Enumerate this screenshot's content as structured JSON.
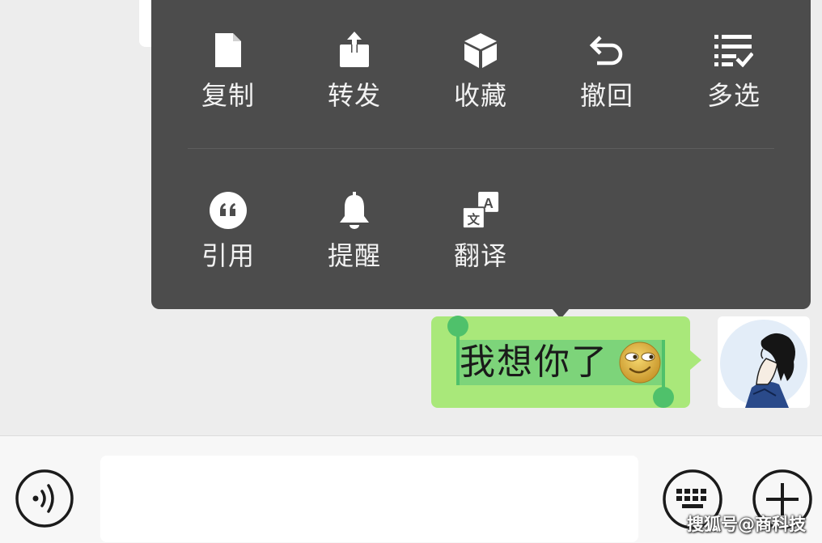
{
  "menu": {
    "row1": [
      {
        "label": "复制",
        "icon": "copy-document-icon"
      },
      {
        "label": "转发",
        "icon": "forward-share-icon"
      },
      {
        "label": "收藏",
        "icon": "favorite-cube-icon"
      },
      {
        "label": "撤回",
        "icon": "recall-undo-icon"
      },
      {
        "label": "多选",
        "icon": "multi-select-list-icon"
      }
    ],
    "row2": [
      {
        "label": "引用",
        "icon": "quote-icon"
      },
      {
        "label": "提醒",
        "icon": "remind-bell-icon"
      },
      {
        "label": "翻译",
        "icon": "translate-icon"
      }
    ]
  },
  "message": {
    "text": "我想你了",
    "emoji": "smirk-emoji"
  },
  "input": {
    "value": "",
    "placeholder": ""
  },
  "watermark": "搜狐号@商科技",
  "colors": {
    "menu_bg": "#4c4c4c",
    "bubble": "#a9e87a",
    "selection": "#7dd47a",
    "handle": "#4fc16b",
    "chat_bg": "#ededed"
  }
}
